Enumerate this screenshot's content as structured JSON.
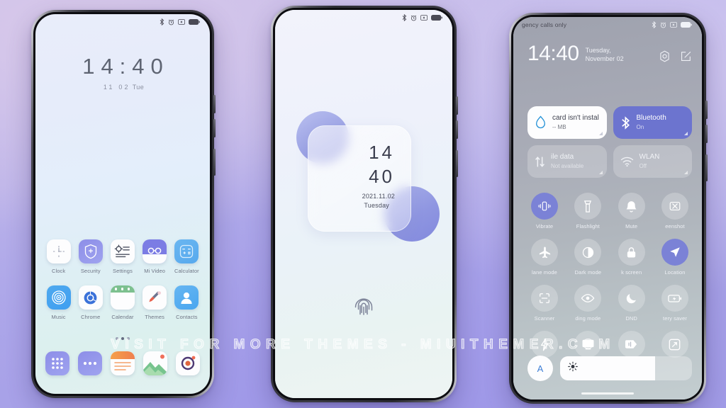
{
  "background": {
    "accent": "#a49fe6",
    "tint": "#c8bce9"
  },
  "watermark": {
    "text": "VISIT FOR MORE THEMES - MIUITHEMER.COM"
  },
  "statusbar": {
    "icons": [
      "bluetooth-icon",
      "alarm-icon",
      "mute-icon",
      "battery-icon"
    ]
  },
  "phone1": {
    "name": "home-screen",
    "clock": {
      "time": "14:40",
      "date": "11 02",
      "weekday": "Tue"
    },
    "apps_row1": [
      {
        "label": "Clock",
        "icon": "clock-icon"
      },
      {
        "label": "Security",
        "icon": "security-shield-icon"
      },
      {
        "label": "Settings",
        "icon": "settings-gear-icon"
      },
      {
        "label": "Mi Video",
        "icon": "mi-video-icon"
      },
      {
        "label": "Calculator",
        "icon": "calculator-icon"
      }
    ],
    "apps_row2": [
      {
        "label": "Music",
        "icon": "music-icon"
      },
      {
        "label": "Chrome",
        "icon": "chrome-icon"
      },
      {
        "label": "Calendar",
        "icon": "calendar-icon"
      },
      {
        "label": "Themes",
        "icon": "themes-brush-icon"
      },
      {
        "label": "Contacts",
        "icon": "contacts-icon"
      }
    ],
    "dock": [
      {
        "label": "App drawer",
        "icon": "app-drawer-icon"
      },
      {
        "label": "Messages",
        "icon": "messages-icon"
      },
      {
        "label": "Notes",
        "icon": "notes-icon"
      },
      {
        "label": "Gallery",
        "icon": "gallery-icon"
      },
      {
        "label": "Camera",
        "icon": "camera-icon"
      }
    ],
    "page_indicator": {
      "pages": 3,
      "active": 1
    }
  },
  "phone2": {
    "name": "lock-screen",
    "card": {
      "hours": "14",
      "minutes": "40",
      "date": "2021.11.02",
      "weekday": "Tuesday"
    },
    "unlock": {
      "icon": "fingerprint-icon"
    }
  },
  "phone3": {
    "name": "control-center",
    "header": {
      "carrier": "gency calls only",
      "time": "14:40",
      "date": "Tuesday, November 02",
      "actions": [
        {
          "icon": "settings-icon",
          "label": "Settings"
        },
        {
          "icon": "edit-icon",
          "label": "Edit"
        }
      ]
    },
    "big_tiles": [
      {
        "title": "card isn't instal",
        "sub": "-- MB",
        "icon": "data-drop-icon",
        "state": "white"
      },
      {
        "title": "Bluetooth",
        "sub": "On",
        "icon": "bluetooth-icon",
        "state": "on"
      },
      {
        "title": "ile data",
        "sub": "Not available",
        "icon": "mobile-data-icon",
        "state": "off"
      },
      {
        "title": "WLAN",
        "sub": "Off",
        "icon": "wlan-icon",
        "state": "off"
      }
    ],
    "toggles_row1": [
      {
        "label": "Vibrate",
        "icon": "vibrate-icon",
        "active": true
      },
      {
        "label": "Flashlight",
        "icon": "flashlight-icon",
        "active": false
      },
      {
        "label": "Mute",
        "icon": "bell-mute-icon",
        "active": false
      },
      {
        "label": "eenshot",
        "icon": "screenshot-icon",
        "active": false
      }
    ],
    "toggles_row2": [
      {
        "label": "lane mode",
        "icon": "airplane-icon",
        "active": false
      },
      {
        "label": "Dark mode",
        "icon": "dark-mode-icon",
        "active": false
      },
      {
        "label": "k screen",
        "icon": "lock-icon",
        "active": false
      },
      {
        "label": "Location",
        "icon": "location-icon",
        "active": true
      }
    ],
    "toggles_row3": [
      {
        "label": "Scanner",
        "icon": "scanner-icon",
        "active": false
      },
      {
        "label": "ding mode",
        "icon": "reading-eye-icon",
        "active": false
      },
      {
        "label": "DND",
        "icon": "moon-icon",
        "active": false
      },
      {
        "label": "tery saver",
        "icon": "battery-saver-icon",
        "active": false
      }
    ],
    "toggles_row4": [
      {
        "label": "",
        "icon": "lightning-icon",
        "active": false
      },
      {
        "label": "",
        "icon": "cast-screen-icon",
        "active": false
      },
      {
        "label": "",
        "icon": "video-toolbox-icon",
        "active": false
      },
      {
        "label": "",
        "icon": "resize-icon",
        "active": false
      }
    ],
    "brightness": {
      "auto_label": "A",
      "level_percent": 72,
      "icon": "sun-icon"
    }
  }
}
